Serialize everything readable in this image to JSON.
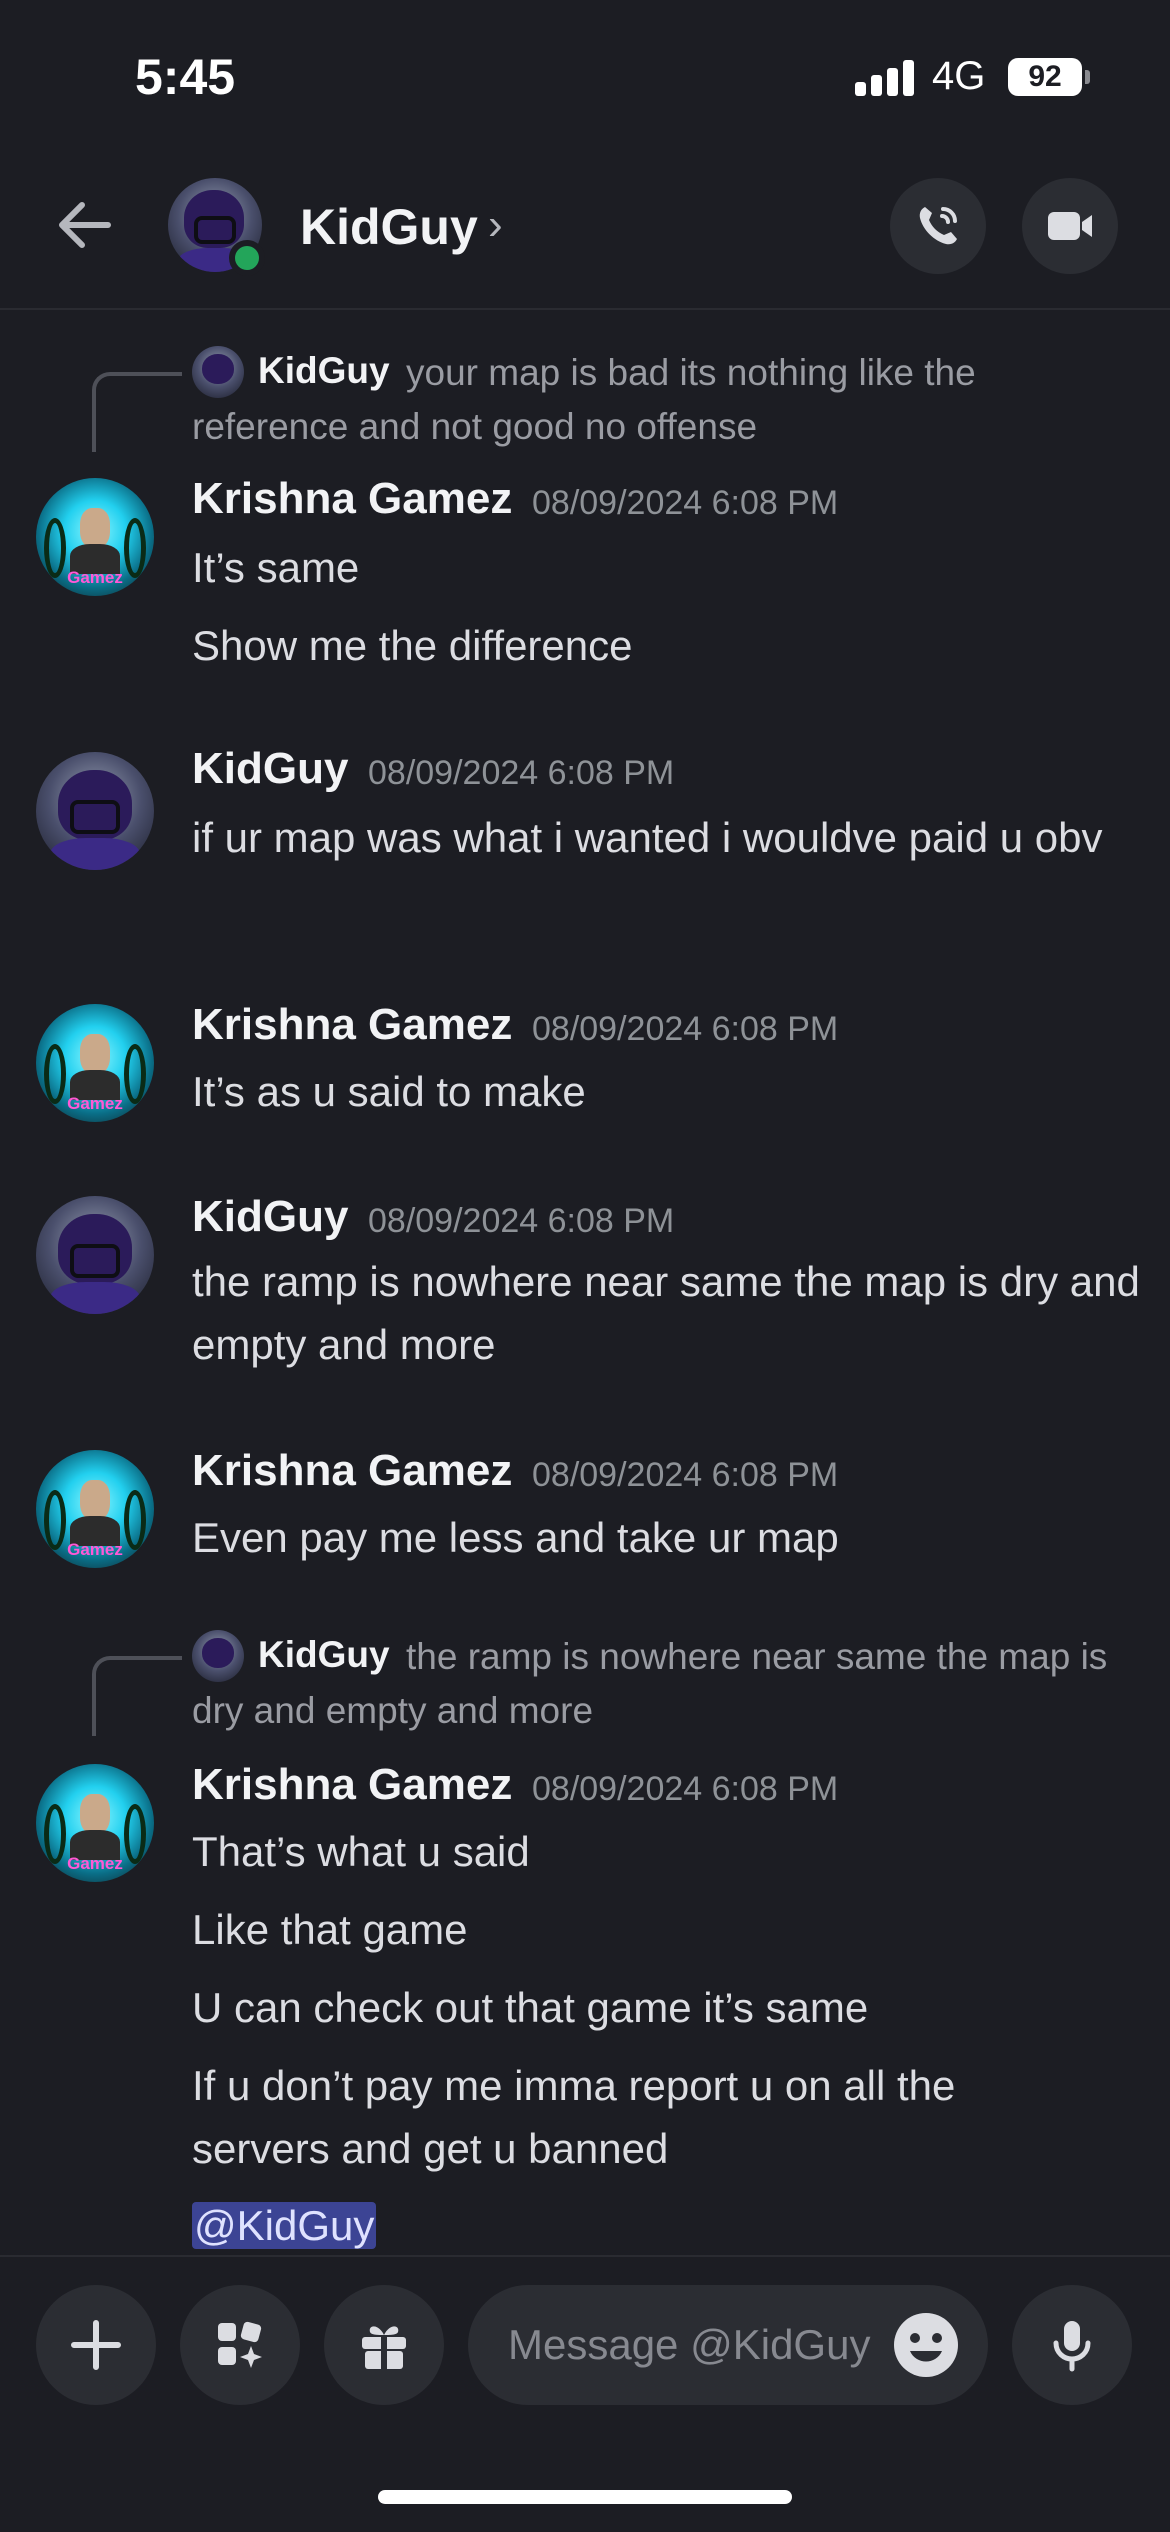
{
  "status_bar": {
    "time": "5:45",
    "network": "4G",
    "battery": "92"
  },
  "header": {
    "contact_name": "KidGuy",
    "chevron": "›",
    "online": true
  },
  "messages": [
    {
      "reply": {
        "author": "KidGuy",
        "text": "your map is bad its nothing like the reference and not good no offense"
      },
      "author": "Krishna Gamez",
      "timestamp": "08/09/2024 6:08 PM",
      "lines": [
        "It’s same",
        "Show me the difference"
      ]
    },
    {
      "author": "KidGuy",
      "timestamp": "08/09/2024 6:08 PM",
      "lines": [
        "if ur map was what i wanted i wouldve paid u obv"
      ]
    },
    {
      "author": "Krishna Gamez",
      "timestamp": "08/09/2024 6:08 PM",
      "lines": [
        "It’s as u said to make"
      ]
    },
    {
      "author": "KidGuy",
      "timestamp": "08/09/2024 6:08 PM",
      "lines": [
        "the ramp is nowhere near same the map is dry and empty and more"
      ]
    },
    {
      "author": "Krishna Gamez",
      "timestamp": "08/09/2024 6:08 PM",
      "lines": [
        "Even pay me less and take ur map"
      ]
    },
    {
      "reply": {
        "author": "KidGuy",
        "text": "the ramp is nowhere near same the map is dry and empty and more"
      },
      "author": "Krishna Gamez",
      "timestamp": "08/09/2024 6:08 PM",
      "lines": [
        "That’s what u said",
        "Like that game",
        "U can check out that game it’s same",
        "If u don’t pay me imma report u on all the servers and get u banned"
      ],
      "mention": "@KidGuy"
    }
  ],
  "avatar_text": {
    "krishna": "Gamez"
  },
  "composer": {
    "placeholder": "Message @KidGuy"
  },
  "colors": {
    "background": "#1c1d23",
    "online": "#23a55a",
    "mention": "#5865f2"
  },
  "icons": [
    "back-arrow-icon",
    "phone-icon",
    "video-icon",
    "plus-icon",
    "apps-icon",
    "gift-icon",
    "emoji-icon",
    "mic-icon"
  ]
}
